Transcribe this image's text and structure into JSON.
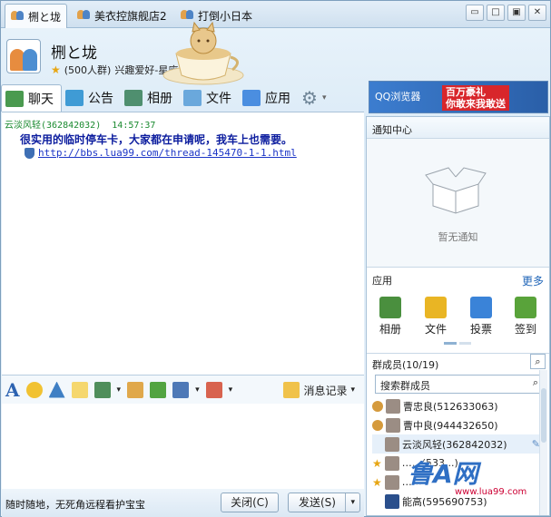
{
  "tabs": [
    {
      "label": "㭢と垅",
      "active": true
    },
    {
      "label": "美衣控旗舰店2",
      "active": false
    },
    {
      "label": "打倒小日本",
      "active": false
    }
  ],
  "window": {
    "buttons": [
      "▭",
      "□",
      "▣",
      "✕"
    ]
  },
  "header": {
    "name": "㭢と垅",
    "members": "(500人群)",
    "desc": "兴趣爱好-星座"
  },
  "ad": {
    "brand": "QQ浏览器",
    "slogan_line1": "百万豪礼",
    "slogan_line2": "你敢来我敢送"
  },
  "toolbar": [
    {
      "label": "聊天",
      "color": "#4a9a4f"
    },
    {
      "label": "公告",
      "color": "#3f9bd5"
    },
    {
      "label": "相册",
      "color": "#4f8f6f"
    },
    {
      "label": "文件",
      "color": "#6aa8dc"
    },
    {
      "label": "应用",
      "color": "#4b8ee0"
    }
  ],
  "chat": {
    "sender": "云淡风轻(362842032)",
    "time": "14:57:37",
    "message": "很实用的临时停车卡，大家都在申请呢，我车上也需要。",
    "link": "http://bbs.lua99.com/thread-145470-1-1.html"
  },
  "format": {
    "history": "消息记录"
  },
  "footer": {
    "tip": "随时随地，无死角远程看护宝宝",
    "close": "关闭(C)",
    "send": "发送(S)"
  },
  "right": {
    "notice_title": "通知中心",
    "notice_empty": "暂无通知",
    "apps_title": "应用",
    "apps_more": "更多",
    "apps": [
      {
        "label": "相册",
        "color": "#4a8f3e"
      },
      {
        "label": "文件",
        "color": "#e9b524"
      },
      {
        "label": "投票",
        "color": "#3a83d8"
      },
      {
        "label": "签到",
        "color": "#59a33a"
      }
    ],
    "members_title": "群成员",
    "members_count": "(10/19)",
    "search_placeholder": "搜索群成员",
    "members": [
      {
        "name": "曹忠良(512633063)"
      },
      {
        "name": "曹中良(944432650)"
      },
      {
        "name": "云淡风轻(362842032)"
      },
      {
        "name": "……(533...)"
      },
      {
        "name": "……"
      },
      {
        "name": "能高(595690753)"
      }
    ]
  },
  "watermark": {
    "text": "鲁A网",
    "url": "www.lua99.com"
  }
}
